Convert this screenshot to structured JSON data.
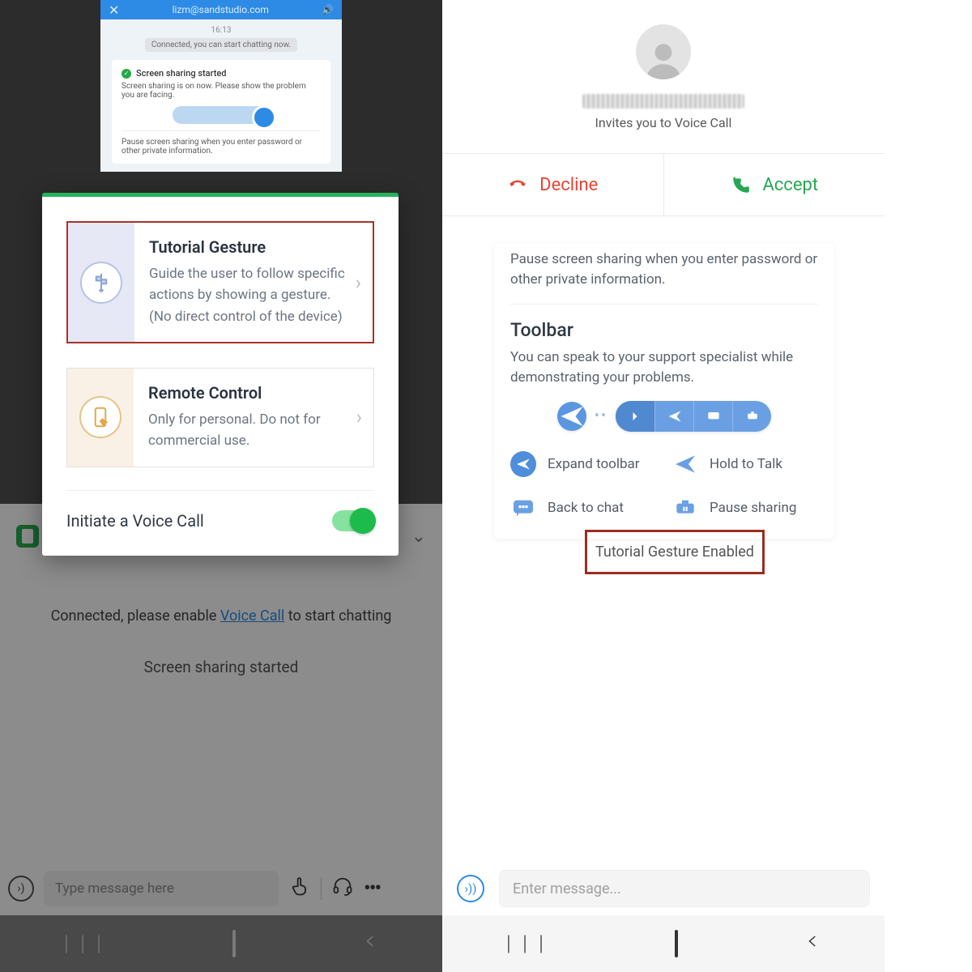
{
  "left": {
    "chat": {
      "header_close": "✕",
      "header_title": "lizm@sandstudio.com",
      "header_speaker": "🔊",
      "time": "16:13",
      "connected_pill": "Connected, you can start chatting now.",
      "card": {
        "title": "Screen sharing started",
        "line1": "Screen sharing is on now. Please show the problem you are facing.",
        "line2": "Pause screen sharing when you enter password or other private information."
      }
    },
    "modal": {
      "options": [
        {
          "title": "Tutorial Gesture",
          "desc": "Guide the user to follow specific actions by showing a gesture. (No direct control of the device)"
        },
        {
          "title": "Remote Control",
          "desc": "Only for personal. Do not for commercial use."
        }
      ],
      "voice_label": "Initiate a Voice Call",
      "voice_on": true
    },
    "background": {
      "connected": "Connected, please enable ",
      "voice_call_link": "Voice Call",
      "connected_tail": " to start chatting",
      "share_started": "Screen sharing started",
      "message_placeholder": "Type message here"
    }
  },
  "right": {
    "call": {
      "invite_text": "Invites you to Voice Call",
      "decline": "Decline",
      "accept": "Accept"
    },
    "toolbar_card": {
      "pause_text": "Pause screen sharing when you enter password or other private information.",
      "title": "Toolbar",
      "subtitle": "You can speak to your support specialist while demonstrating your problems.",
      "items": [
        "Expand toolbar",
        "Hold to Talk",
        "Back to chat",
        "Pause sharing"
      ]
    },
    "gesture_pill": "Tutorial Gesture Enabled",
    "message_placeholder": "Enter message..."
  }
}
